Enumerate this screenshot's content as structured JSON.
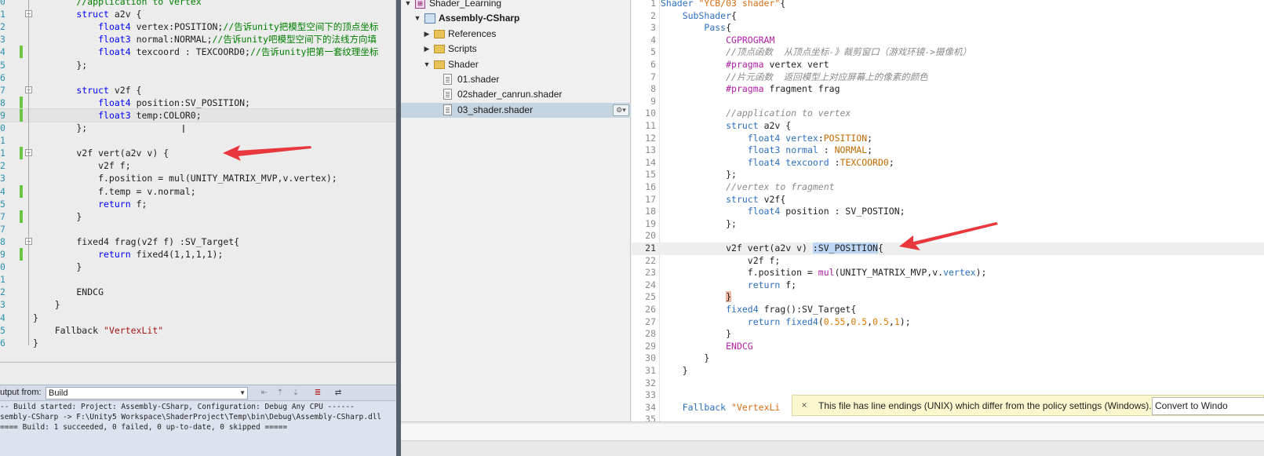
{
  "vs_editor": {
    "lines": [
      {
        "num": "0",
        "code": [
          {
            "t": "        //application to vertex",
            "c": "cm"
          }
        ]
      },
      {
        "num": "1",
        "code": [
          {
            "t": "        ",
            "c": ""
          },
          {
            "t": "struct",
            "c": "kw"
          },
          {
            "t": " a2v {",
            "c": ""
          }
        ]
      },
      {
        "num": "2",
        "code": [
          {
            "t": "            ",
            "c": ""
          },
          {
            "t": "float4",
            "c": "kw"
          },
          {
            "t": " vertex:POSITION;",
            "c": ""
          },
          {
            "t": "//告诉unity把模型空间下的顶点坐标",
            "c": "cm"
          }
        ]
      },
      {
        "num": "3",
        "code": [
          {
            "t": "            ",
            "c": ""
          },
          {
            "t": "float3",
            "c": "kw"
          },
          {
            "t": " normal:NORMAL;",
            "c": ""
          },
          {
            "t": "//告诉unity吧模型空间下的法线方向填",
            "c": "cm"
          }
        ]
      },
      {
        "num": "4",
        "code": [
          {
            "t": "            ",
            "c": ""
          },
          {
            "t": "float4",
            "c": "kw"
          },
          {
            "t": " texcoord : TEXCOORD0;",
            "c": ""
          },
          {
            "t": "//告诉unity把第一套纹理坐标",
            "c": "cm"
          }
        ]
      },
      {
        "num": "5",
        "code": [
          {
            "t": "        };",
            "c": ""
          }
        ]
      },
      {
        "num": "6",
        "code": [
          {
            "t": "",
            "c": ""
          }
        ]
      },
      {
        "num": "7",
        "code": [
          {
            "t": "        ",
            "c": ""
          },
          {
            "t": "struct",
            "c": "kw"
          },
          {
            "t": " v2f {",
            "c": ""
          }
        ]
      },
      {
        "num": "8",
        "code": [
          {
            "t": "            ",
            "c": ""
          },
          {
            "t": "float4",
            "c": "kw"
          },
          {
            "t": " position:SV_POSITION;",
            "c": ""
          }
        ]
      },
      {
        "num": "9",
        "code": [
          {
            "t": "            ",
            "c": ""
          },
          {
            "t": "float3",
            "c": "kw"
          },
          {
            "t": " temp:COLOR0;",
            "c": ""
          }
        ]
      },
      {
        "num": "0",
        "code": [
          {
            "t": "        };",
            "c": ""
          }
        ]
      },
      {
        "num": "1",
        "code": [
          {
            "t": "",
            "c": ""
          }
        ]
      },
      {
        "num": "1",
        "code": [
          {
            "t": "        v2f vert(a2v v) {",
            "c": ""
          }
        ]
      },
      {
        "num": "2",
        "code": [
          {
            "t": "            v2f f;",
            "c": ""
          }
        ]
      },
      {
        "num": "3",
        "code": [
          {
            "t": "            f.position = mul(UNITY_MATRIX_MVP,v.vertex);",
            "c": ""
          }
        ]
      },
      {
        "num": "4",
        "code": [
          {
            "t": "            f.temp = v.normal;",
            "c": ""
          }
        ]
      },
      {
        "num": "5",
        "code": [
          {
            "t": "            ",
            "c": ""
          },
          {
            "t": "return",
            "c": "kw"
          },
          {
            "t": " f;",
            "c": ""
          }
        ]
      },
      {
        "num": "7",
        "code": [
          {
            "t": "        }",
            "c": ""
          }
        ]
      },
      {
        "num": "7",
        "code": [
          {
            "t": "",
            "c": ""
          }
        ]
      },
      {
        "num": "8",
        "code": [
          {
            "t": "        fixed4 frag(v2f f) :SV_Target{",
            "c": ""
          }
        ]
      },
      {
        "num": "9",
        "code": [
          {
            "t": "            ",
            "c": ""
          },
          {
            "t": "return",
            "c": "kw"
          },
          {
            "t": " fixed4(1,1,1,1);",
            "c": ""
          }
        ]
      },
      {
        "num": "0",
        "code": [
          {
            "t": "        }",
            "c": ""
          }
        ]
      },
      {
        "num": "1",
        "code": [
          {
            "t": "",
            "c": ""
          }
        ]
      },
      {
        "num": "2",
        "code": [
          {
            "t": "        ENDCG",
            "c": ""
          }
        ]
      },
      {
        "num": "3",
        "code": [
          {
            "t": "    }",
            "c": ""
          }
        ]
      },
      {
        "num": "4",
        "code": [
          {
            "t": "}",
            "c": ""
          }
        ]
      },
      {
        "num": "5",
        "code": [
          {
            "t": "    Fallback ",
            "c": ""
          },
          {
            "t": "\"VertexLit\"",
            "c": "st"
          }
        ]
      },
      {
        "num": "6",
        "code": [
          {
            "t": "}",
            "c": ""
          }
        ]
      }
    ]
  },
  "vs_output": {
    "label": "utput from:",
    "selected": "Build",
    "lines": [
      "-- Build started: Project: Assembly-CSharp, Configuration: Debug Any CPU ------",
      "sembly-CSharp -> F:\\Unity5 Workspace\\ShaderProject\\Temp\\bin\\Debug\\Assembly-CSharp.dll",
      "==== Build: 1 succeeded, 0 failed, 0 up-to-date, 0 skipped ====="
    ]
  },
  "solution": {
    "items": [
      {
        "label": "Shader_Learning",
        "icon": "solution-icon",
        "arrow": "▼",
        "indent": 0,
        "bold": false
      },
      {
        "label": "Assembly-CSharp",
        "icon": "project-icon",
        "arrow": "▼",
        "indent": 1,
        "bold": true
      },
      {
        "label": "References",
        "icon": "folder-icon",
        "arrow": "▶",
        "indent": 2,
        "bold": false
      },
      {
        "label": "Scripts",
        "icon": "folder-icon",
        "arrow": "▶",
        "indent": 2,
        "bold": false
      },
      {
        "label": "Shader",
        "icon": "folder-icon",
        "arrow": "▼",
        "indent": 2,
        "bold": false
      },
      {
        "label": "01.shader",
        "icon": "file-icon",
        "arrow": "",
        "indent": 3,
        "bold": false
      },
      {
        "label": "02shader_canrun.shader",
        "icon": "file-icon",
        "arrow": "",
        "indent": 3,
        "bold": false
      },
      {
        "label": "03_shader.shader",
        "icon": "file-icon",
        "arrow": "",
        "indent": 3,
        "bold": false,
        "selected": true
      }
    ],
    "gear": "⚙▾"
  },
  "md_editor": {
    "lines": [
      {
        "num": "1",
        "code": [
          {
            "t": "Shader ",
            "c": "kw"
          },
          {
            "t": "\"YCB/03 shader\"",
            "c": "st"
          },
          {
            "t": "{",
            "c": ""
          }
        ]
      },
      {
        "num": "2",
        "code": [
          {
            "t": "    ",
            "c": ""
          },
          {
            "t": "SubShader",
            "c": "kw"
          },
          {
            "t": "{",
            "c": ""
          }
        ]
      },
      {
        "num": "3",
        "code": [
          {
            "t": "        ",
            "c": ""
          },
          {
            "t": "Pass",
            "c": "kw"
          },
          {
            "t": "{",
            "c": ""
          }
        ]
      },
      {
        "num": "4",
        "code": [
          {
            "t": "            ",
            "c": ""
          },
          {
            "t": "CGPROGRAM",
            "c": "pp"
          }
        ]
      },
      {
        "num": "5",
        "code": [
          {
            "t": "            ",
            "c": ""
          },
          {
            "t": "//顶点函数  从顶点坐标-》裁剪窗口（游戏环镜->摄像机）",
            "c": "cm"
          }
        ]
      },
      {
        "num": "6",
        "code": [
          {
            "t": "            ",
            "c": ""
          },
          {
            "t": "#pragma",
            "c": "pp"
          },
          {
            "t": " vertex vert",
            "c": ""
          }
        ]
      },
      {
        "num": "7",
        "code": [
          {
            "t": "            ",
            "c": ""
          },
          {
            "t": "//片元函数  返回模型上对应屏幕上的像素的颜色",
            "c": "cm"
          }
        ]
      },
      {
        "num": "8",
        "code": [
          {
            "t": "            ",
            "c": ""
          },
          {
            "t": "#pragma",
            "c": "pp"
          },
          {
            "t": " fragment frag",
            "c": ""
          }
        ]
      },
      {
        "num": "9",
        "code": [
          {
            "t": "",
            "c": ""
          }
        ]
      },
      {
        "num": "10",
        "code": [
          {
            "t": "            ",
            "c": ""
          },
          {
            "t": "//application to vertex",
            "c": "cm"
          }
        ]
      },
      {
        "num": "11",
        "code": [
          {
            "t": "            ",
            "c": ""
          },
          {
            "t": "struct",
            "c": "kw"
          },
          {
            "t": " a2v {",
            "c": ""
          }
        ]
      },
      {
        "num": "12",
        "code": [
          {
            "t": "                ",
            "c": ""
          },
          {
            "t": "float4",
            "c": "kw"
          },
          {
            "t": " ",
            "c": ""
          },
          {
            "t": "vertex",
            "c": "kw"
          },
          {
            "t": ":",
            "c": ""
          },
          {
            "t": "POSITION",
            "c": "sem"
          },
          {
            "t": ";",
            "c": ""
          }
        ]
      },
      {
        "num": "13",
        "code": [
          {
            "t": "                ",
            "c": ""
          },
          {
            "t": "float3",
            "c": "kw"
          },
          {
            "t": " ",
            "c": ""
          },
          {
            "t": "normal",
            "c": "kw"
          },
          {
            "t": " : ",
            "c": ""
          },
          {
            "t": "NORMAL",
            "c": "sem"
          },
          {
            "t": ";",
            "c": ""
          }
        ]
      },
      {
        "num": "14",
        "code": [
          {
            "t": "                ",
            "c": ""
          },
          {
            "t": "float4",
            "c": "kw"
          },
          {
            "t": " ",
            "c": ""
          },
          {
            "t": "texcoord",
            "c": "kw"
          },
          {
            "t": " :",
            "c": ""
          },
          {
            "t": "TEXCOORD0",
            "c": "sem"
          },
          {
            "t": ";",
            "c": ""
          }
        ]
      },
      {
        "num": "15",
        "code": [
          {
            "t": "            };",
            "c": ""
          }
        ]
      },
      {
        "num": "16",
        "code": [
          {
            "t": "            ",
            "c": ""
          },
          {
            "t": "//vertex to fragment",
            "c": "cm"
          }
        ]
      },
      {
        "num": "17",
        "code": [
          {
            "t": "            ",
            "c": ""
          },
          {
            "t": "struct",
            "c": "kw"
          },
          {
            "t": " v2f{",
            "c": ""
          }
        ]
      },
      {
        "num": "18",
        "code": [
          {
            "t": "                ",
            "c": ""
          },
          {
            "t": "float4",
            "c": "kw"
          },
          {
            "t": " position : SV_POSTION;",
            "c": ""
          }
        ]
      },
      {
        "num": "19",
        "code": [
          {
            "t": "            };",
            "c": ""
          }
        ]
      },
      {
        "num": "20",
        "code": [
          {
            "t": "",
            "c": ""
          }
        ]
      },
      {
        "num": "21",
        "code": [
          {
            "t": "            v2f vert(a2v v) ",
            "c": ""
          },
          {
            "t": ":SV_POSITION",
            "c": "sel"
          },
          {
            "t": "{",
            "c": ""
          }
        ],
        "current": true
      },
      {
        "num": "22",
        "code": [
          {
            "t": "                v2f f;",
            "c": ""
          }
        ]
      },
      {
        "num": "23",
        "code": [
          {
            "t": "                f.position = ",
            "c": ""
          },
          {
            "t": "mul",
            "c": "pp"
          },
          {
            "t": "(UNITY_MATRIX_MVP,v.",
            "c": ""
          },
          {
            "t": "vertex",
            "c": "kw"
          },
          {
            "t": ");",
            "c": ""
          }
        ]
      },
      {
        "num": "24",
        "code": [
          {
            "t": "                ",
            "c": ""
          },
          {
            "t": "return",
            "c": "kw"
          },
          {
            "t": " f;",
            "c": ""
          }
        ]
      },
      {
        "num": "25",
        "code": [
          {
            "t": "            ",
            "c": ""
          },
          {
            "t": "}",
            "c": "brace"
          }
        ]
      },
      {
        "num": "26",
        "code": [
          {
            "t": "            ",
            "c": ""
          },
          {
            "t": "fixed4",
            "c": "kw"
          },
          {
            "t": " frag():SV_Target{",
            "c": ""
          }
        ]
      },
      {
        "num": "27",
        "code": [
          {
            "t": "                ",
            "c": ""
          },
          {
            "t": "return",
            "c": "kw"
          },
          {
            "t": " ",
            "c": ""
          },
          {
            "t": "fixed4",
            "c": "kw"
          },
          {
            "t": "(",
            "c": ""
          },
          {
            "t": "0.55",
            "c": "num"
          },
          {
            "t": ",",
            "c": ""
          },
          {
            "t": "0.5",
            "c": "num"
          },
          {
            "t": ",",
            "c": ""
          },
          {
            "t": "0.5",
            "c": "num"
          },
          {
            "t": ",",
            "c": ""
          },
          {
            "t": "1",
            "c": "num"
          },
          {
            "t": ");",
            "c": ""
          }
        ]
      },
      {
        "num": "28",
        "code": [
          {
            "t": "            }",
            "c": ""
          }
        ]
      },
      {
        "num": "29",
        "code": [
          {
            "t": "            ",
            "c": ""
          },
          {
            "t": "ENDCG",
            "c": "pp"
          }
        ]
      },
      {
        "num": "30",
        "code": [
          {
            "t": "        }",
            "c": ""
          }
        ]
      },
      {
        "num": "31",
        "code": [
          {
            "t": "    }",
            "c": ""
          }
        ]
      },
      {
        "num": "32",
        "code": [
          {
            "t": "",
            "c": ""
          }
        ]
      },
      {
        "num": "33",
        "code": [
          {
            "t": "",
            "c": ""
          }
        ]
      },
      {
        "num": "34",
        "code": [
          {
            "t": "    ",
            "c": ""
          },
          {
            "t": "Fallback",
            "c": "kw"
          },
          {
            "t": " ",
            "c": ""
          },
          {
            "t": "\"VertexLi",
            "c": "st"
          }
        ]
      },
      {
        "num": "35",
        "code": [
          {
            "t": "",
            "c": ""
          }
        ]
      }
    ]
  },
  "notification": {
    "close": "×",
    "text": "This file has line endings (UNIX) which differ from the policy settings (Windows).",
    "button": "Convert to Windo"
  },
  "colors": {
    "arrow": "#e8383d",
    "selection": "#bcd6f3",
    "tree_selected": "#c4d4e0"
  }
}
